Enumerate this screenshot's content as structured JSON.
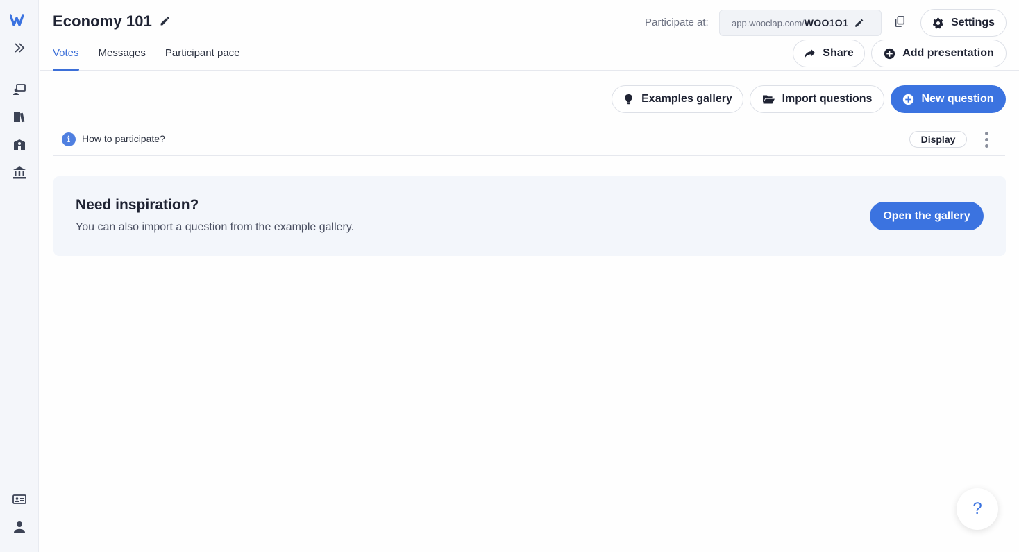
{
  "sidebar": {
    "logo": "wooclap-logo",
    "items": [
      {
        "icon": "expand-icon"
      },
      {
        "icon": "presentation-icon"
      },
      {
        "icon": "library-icon"
      },
      {
        "icon": "school-icon"
      },
      {
        "icon": "institution-icon"
      },
      {
        "icon": "id-card-icon"
      },
      {
        "icon": "user-icon"
      }
    ]
  },
  "header": {
    "title": "Economy 101",
    "tabs": [
      {
        "label": "Votes",
        "active": true
      },
      {
        "label": "Messages",
        "active": false
      },
      {
        "label": "Participant pace",
        "active": false
      }
    ],
    "participate_label": "Participate at:",
    "url_prefix": "app.wooclap.com/",
    "event_code": "WOO1O1",
    "settings_label": "Settings",
    "share_label": "Share",
    "add_presentation_label": "Add presentation"
  },
  "toolbar": {
    "examples_label": "Examples gallery",
    "import_label": "Import questions",
    "new_question_label": "New question"
  },
  "info_row": {
    "text": "How to participate?",
    "display_label": "Display"
  },
  "inspiration": {
    "title": "Need inspiration?",
    "subtitle": "You can also import a question from the example gallery.",
    "button_label": "Open the gallery"
  },
  "help": {
    "label": "?"
  },
  "colors": {
    "accent": "#3b73e0",
    "sidebar_bg": "#f4f6fa",
    "panel_bg": "#f3f6fb"
  }
}
